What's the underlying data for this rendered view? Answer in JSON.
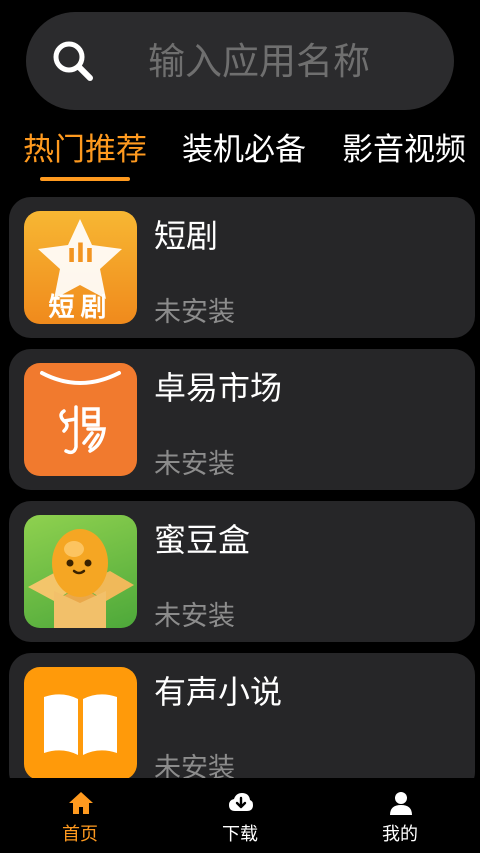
{
  "search": {
    "placeholder": "输入应用名称",
    "icon": "search-icon"
  },
  "tabs": [
    {
      "label": "热门推荐",
      "active": true
    },
    {
      "label": "装机必备",
      "active": false
    },
    {
      "label": "影音视频",
      "active": false
    }
  ],
  "apps": [
    {
      "name": "短剧",
      "status": "未安装",
      "icon": "short-drama-app-icon",
      "icon_text": "短剧",
      "icon_mark": "ılı"
    },
    {
      "name": "卓易市场",
      "status": "未安装",
      "icon": "zhuoyi-market-app-icon"
    },
    {
      "name": "蜜豆盒",
      "status": "未安装",
      "icon": "midou-box-app-icon"
    },
    {
      "name": "有声小说",
      "status": "未安装",
      "icon": "book-app-icon"
    }
  ],
  "bottom_nav": [
    {
      "label": "首页",
      "icon": "home-icon",
      "active": true
    },
    {
      "label": "下载",
      "icon": "download-icon",
      "active": false
    },
    {
      "label": "我的",
      "icon": "profile-icon",
      "active": false
    }
  ],
  "colors": {
    "accent": "#ff9a1f",
    "card": "#262628",
    "search_bg": "#2b2b2d",
    "muted": "#8c8c8c"
  }
}
